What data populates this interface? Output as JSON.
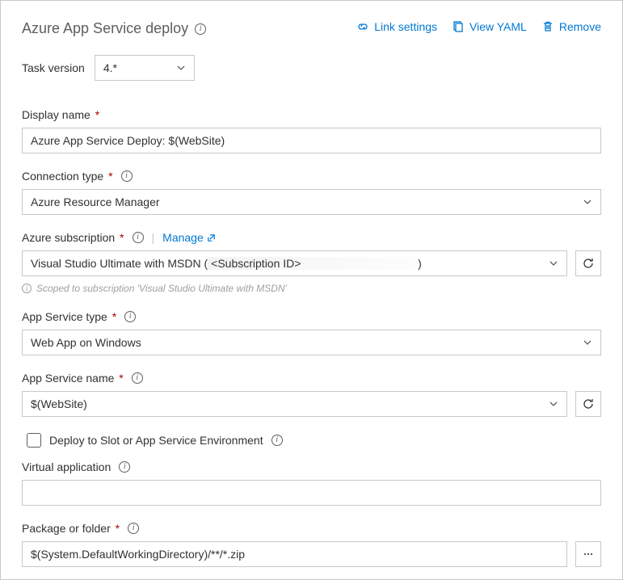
{
  "header": {
    "title": "Azure App Service deploy",
    "actions": {
      "link_settings": "Link settings",
      "view_yaml": "View YAML",
      "remove": "Remove"
    }
  },
  "task_version": {
    "label": "Task version",
    "value": "4.*"
  },
  "fields": {
    "display_name": {
      "label": "Display name",
      "value": "Azure App Service Deploy: $(WebSite)"
    },
    "connection_type": {
      "label": "Connection type",
      "value": "Azure Resource Manager"
    },
    "azure_subscription": {
      "label": "Azure subscription",
      "manage": "Manage",
      "value_prefix": "Visual Studio Ultimate with MSDN (",
      "subscription_id_mask": "<Subscription ID>",
      "value_suffix": ")",
      "scope_note": "Scoped to subscription 'Visual Studio Ultimate with MSDN'"
    },
    "app_service_type": {
      "label": "App Service type",
      "value": "Web App on Windows"
    },
    "app_service_name": {
      "label": "App Service name",
      "value": "$(WebSite)"
    },
    "deploy_to_slot": {
      "label": "Deploy to Slot or App Service Environment",
      "checked": false
    },
    "virtual_application": {
      "label": "Virtual application",
      "value": ""
    },
    "package_or_folder": {
      "label": "Package or folder",
      "value": "$(System.DefaultWorkingDirectory)/**/*.zip"
    }
  }
}
